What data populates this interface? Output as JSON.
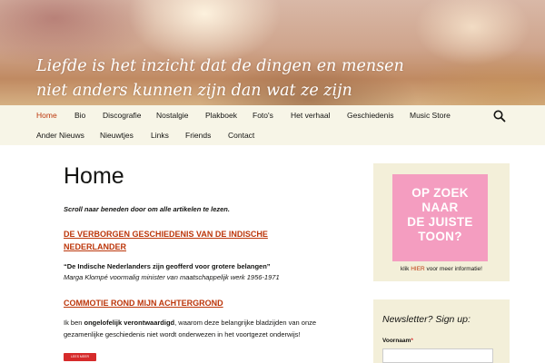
{
  "header": {
    "tagline_line1": "Liefde is het inzicht dat de dingen en mensen",
    "tagline_line2": "niet anders kunnen zijn dan wat ze zijn"
  },
  "nav": {
    "row1": [
      "Home",
      "Bio",
      "Discografie",
      "Nostalgie",
      "Plakboek",
      "Foto's",
      "Het verhaal",
      "Geschiedenis",
      "Music Store"
    ],
    "row2": [
      "Ander Nieuws",
      "Nieuwtjes",
      "Links",
      "Friends",
      "Contact"
    ],
    "active": "Home",
    "search_icon": "search-icon"
  },
  "main": {
    "page_title": "Home",
    "intro": "Scroll naar beneden door om alle artikelen te lezen.",
    "post1_title": "DE VERBORGEN GESCHIEDENIS VAN DE INDISCHE NEDERLANDER",
    "quote": "“De Indische Nederlanders zijn geofferd voor grotere belangen”",
    "quote_source": "Marga Klompé voormalig minister van maatschappelijk werk 1956-1971",
    "post2_title": "COMMOTIE ROND MIJN ACHTERGROND",
    "body_prefix": "Ik ben ",
    "body_bold": "ongelofelijk verontwaardigd",
    "body_suffix": ", waarom deze belangrijke bladzijden van onze gezamenlijke geschiedenis niet wordt onderwezen in het voortgezet onderwijs!",
    "read_more": "LEES MEER"
  },
  "sidebar": {
    "promo_line1": "OP ZOEK",
    "promo_line2": "NAAR",
    "promo_line3": "DE JUISTE",
    "promo_line4": "TOON?",
    "caption_prefix": "klik ",
    "caption_link": "HIER",
    "caption_suffix": " voor meer informatie!",
    "newsletter_title": "Newsletter? Sign up:",
    "field_label": "Voornaam",
    "field_required": "*",
    "field_value": ""
  },
  "colors": {
    "accent": "#bc360a",
    "nav_bg": "#f7f5e7",
    "sidebar_bg": "#f3efd9",
    "promo_bg": "#f49dc0",
    "button_red": "#d62b2b"
  }
}
